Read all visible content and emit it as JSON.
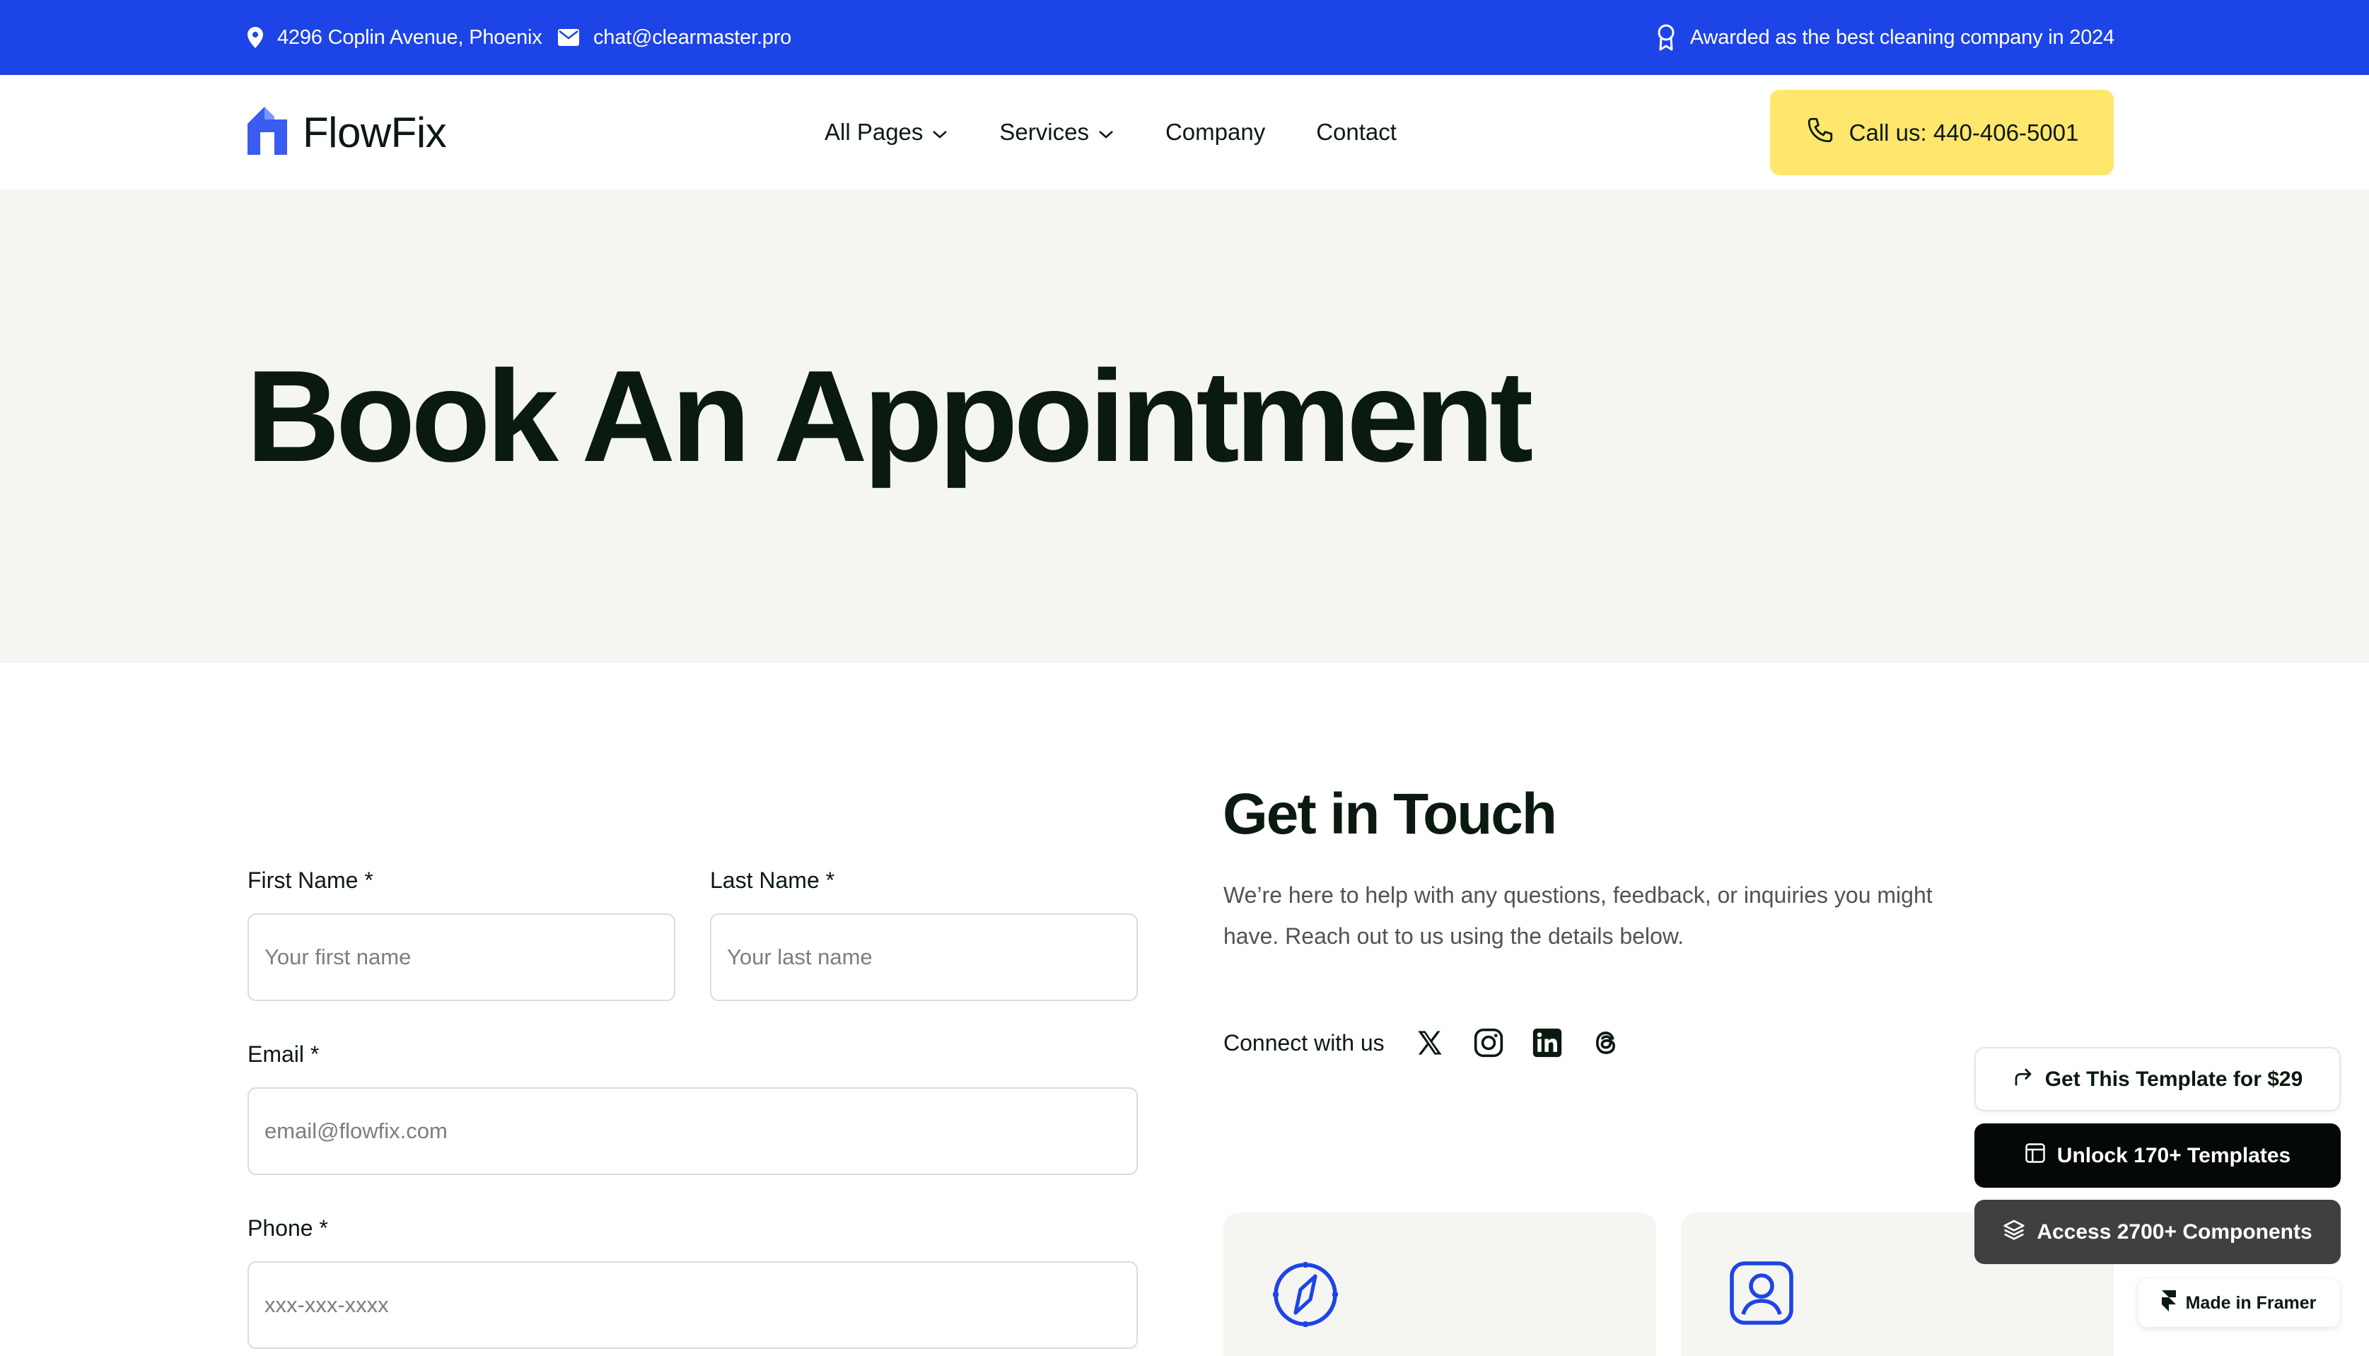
{
  "topbar": {
    "address": "4296 Coplin Avenue, Phoenix",
    "email": "chat@clearmaster.pro",
    "award": "Awarded as the best cleaning company in 2024",
    "icons": [
      "map-pin-icon",
      "mail-icon",
      "award-icon"
    ]
  },
  "nav": {
    "logo": "FlowFix",
    "items": [
      {
        "label": "All Pages",
        "dropdown": true
      },
      {
        "label": "Services",
        "dropdown": true
      },
      {
        "label": "Company",
        "dropdown": false
      },
      {
        "label": "Contact",
        "dropdown": false
      }
    ],
    "call_label": "Call us: 440-406-5001"
  },
  "hero": {
    "title": "Book An Appointment"
  },
  "form": {
    "first_name_label": "First Name *",
    "first_name_placeholder": "Your first name",
    "last_name_label": "Last Name *",
    "last_name_placeholder": "Your last name",
    "email_label": "Email *",
    "email_placeholder": "email@flowfix.com",
    "phone_label": "Phone *",
    "phone_placeholder": "xxx-xxx-xxxx"
  },
  "contact": {
    "title": "Get in Touch",
    "description": "We’re here to help with any questions, feedback, or inquiries you might have. Reach out to us using the details below.",
    "connect_label": "Connect with us",
    "social": [
      "x-icon",
      "instagram-icon",
      "linkedin-icon",
      "threads-icon"
    ],
    "cards": [
      "compass-icon",
      "user-square-icon"
    ]
  },
  "framer": {
    "get_template": "Get This Template for $29",
    "unlock": "Unlock 170+ Templates",
    "access": "Access 2700+ Components",
    "made_in": "Made in Framer"
  },
  "colors": {
    "brand_blue": "#1d44e6",
    "accent_yellow": "#ffe66d",
    "hero_bg": "#f5f5f1",
    "text_dark": "#0b1a10"
  }
}
